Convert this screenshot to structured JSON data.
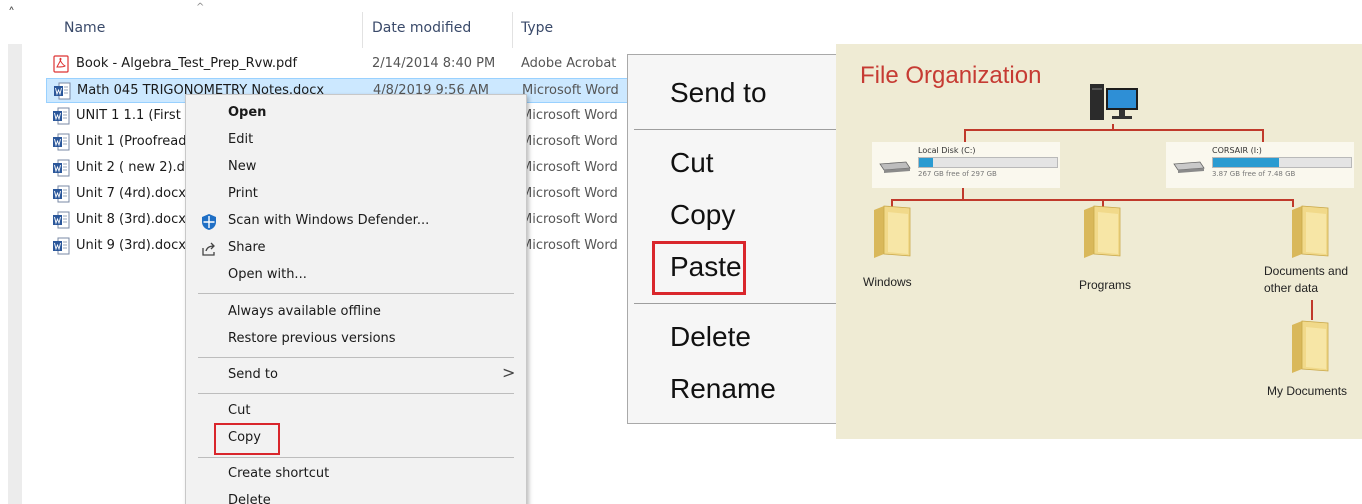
{
  "explorer": {
    "columns": {
      "name": "Name",
      "date": "Date modified",
      "type": "Type"
    },
    "files": [
      {
        "name": "Book - Algebra_Test_Prep_Rvw.pdf",
        "date": "2/14/2014 8:40 PM",
        "type": "Adobe Acrobat",
        "icon": "pdf-icon",
        "selected": false
      },
      {
        "name": "Math 045 TRIGONOMETRY Notes.docx",
        "date": "4/8/2019 9:56 AM",
        "type": "Microsoft Word",
        "icon": "word-doc-icon",
        "selected": true
      },
      {
        "name": "UNIT 1   1.1 (First",
        "date": "",
        "type": "Microsoft Word",
        "icon": "word-doc-icon",
        "selected": false
      },
      {
        "name": "Unit 1 (Proofread",
        "date": "",
        "type": "Microsoft Word",
        "icon": "word-doc-icon",
        "selected": false
      },
      {
        "name": "Unit 2 ( new 2).d",
        "date": "",
        "type": "Microsoft Word",
        "icon": "word-doc-icon",
        "selected": false
      },
      {
        "name": "Unit 7 (4rd).docx",
        "date": "",
        "type": "Microsoft Word",
        "icon": "word-doc-icon",
        "selected": false
      },
      {
        "name": "Unit 8 (3rd).docx",
        "date": "",
        "type": "Microsoft Word",
        "icon": "word-doc-icon",
        "selected": false
      },
      {
        "name": "Unit 9 (3rd).docx",
        "date": "",
        "type": "Microsoft Word",
        "icon": "word-doc-icon",
        "selected": false
      }
    ]
  },
  "context_menu": {
    "open": "Open",
    "edit": "Edit",
    "new": "New",
    "print": "Print",
    "scan": "Scan with Windows Defender...",
    "share": "Share",
    "open_with": "Open with...",
    "offline": "Always available offline",
    "restore": "Restore previous versions",
    "send_to": "Send to",
    "cut": "Cut",
    "copy": "Copy",
    "create_shortcut": "Create shortcut",
    "delete": "Delete"
  },
  "big_menu": {
    "send_to": "Send to",
    "cut": "Cut",
    "copy": "Copy",
    "paste": "Paste",
    "delete": "Delete",
    "rename": "Rename"
  },
  "diagram": {
    "title": "File Organization",
    "drives": [
      {
        "name": "Local Disk (C:)",
        "free": "267 GB free of 297 GB",
        "used_fraction": 0.1
      },
      {
        "name": "CORSAIR (I:)",
        "free": "3.87 GB free of 7.48 GB",
        "used_fraction": 0.48
      }
    ],
    "folders": {
      "windows": "Windows",
      "programs": "Programs",
      "documents_line1": "Documents and",
      "documents_line2": "other data",
      "my_documents": "My Documents"
    }
  },
  "colors": {
    "highlight": "#d9262c",
    "selection": "#cce8ff",
    "diagram_bg": "#efebd4",
    "diagram_title": "#c63b33"
  }
}
